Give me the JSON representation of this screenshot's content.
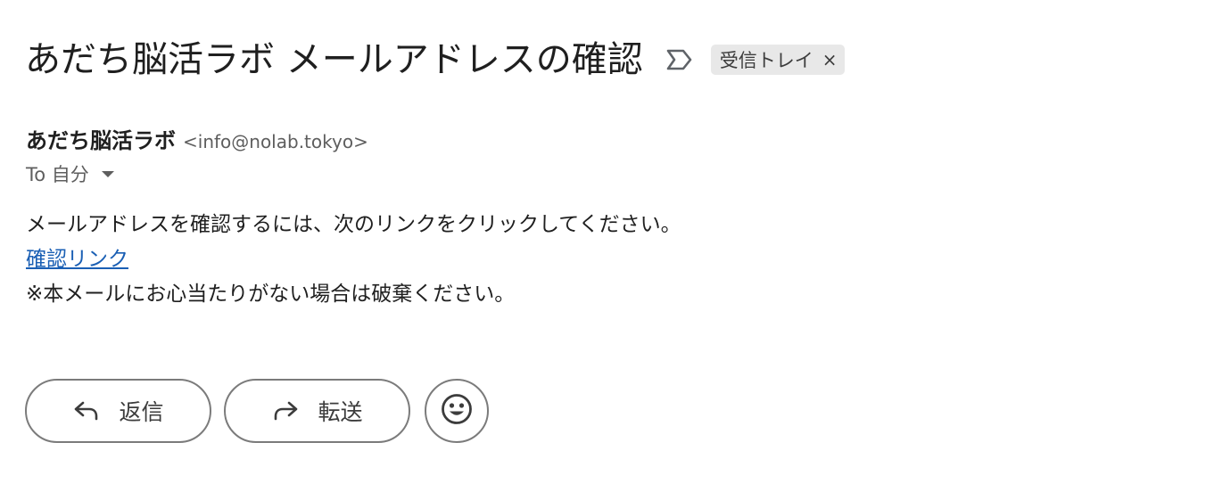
{
  "email": {
    "subject": "あだち脳活ラボ メールアドレスの確認",
    "important_marker_icon": "label-important-outline-icon",
    "label_chip": {
      "text": "受信トレイ",
      "close": "×"
    },
    "sender": {
      "name": "あだち脳活ラボ",
      "email": "<info@nolab.tokyo>"
    },
    "recipient_line": "To 自分",
    "body": {
      "line1": "メールアドレスを確認するには、次のリンクをクリックしてください。",
      "link_text": "確認リンク",
      "line3": "※本メールにお心当たりがない場合は破棄ください。"
    }
  },
  "actions": {
    "reply_label": "返信",
    "reply_icon": "reply-arrow-icon",
    "forward_label": "転送",
    "forward_icon": "forward-arrow-icon",
    "emoji_icon": "smiley-face-icon"
  },
  "colors": {
    "link": "#1a5fb4",
    "chip_background": "#e8e8e8",
    "button_border": "#7b7b7b"
  }
}
